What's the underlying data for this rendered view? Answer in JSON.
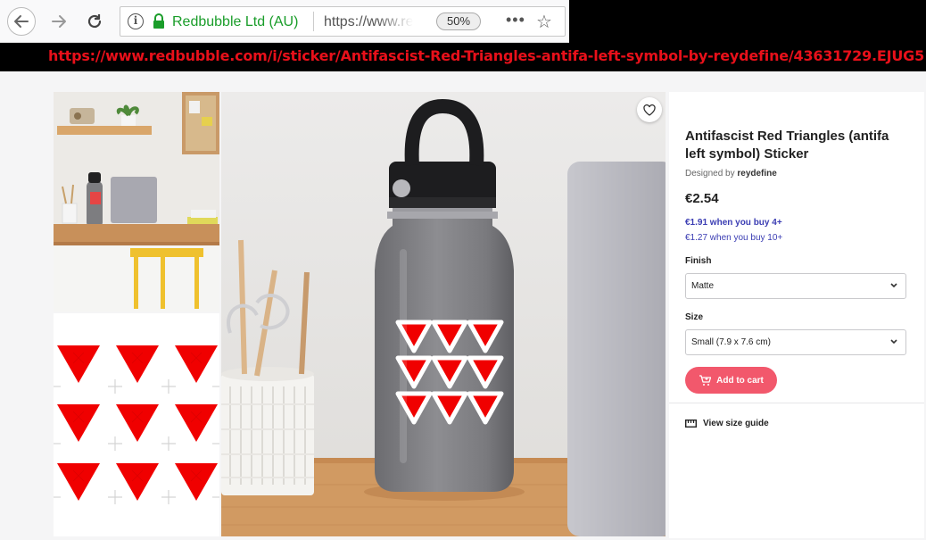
{
  "browser": {
    "org_name": "Redbubble Ltd (AU)",
    "url_partial": "https://www.redbubble.com/i/sticker/",
    "zoom": "50%",
    "menu_dots": "•••",
    "banner_url": "https://www.redbubble.com/i/sticker/Antifascist-Red-Triangles-antifa-left-symbol-by-reydefine/43631729.EJUG5"
  },
  "product": {
    "title": "Antifascist Red Triangles (antifa left symbol) Sticker",
    "designed_by_label": "Designed by",
    "designer": "reydefine",
    "price": "€2.54",
    "bulk_price_1": "€1.91 when you buy 4+",
    "bulk_price_2": "€1.27 when you buy 10+",
    "finish_label": "Finish",
    "finish_value": "Matte",
    "size_label": "Size",
    "size_value": "Small (7.9 x 7.6 cm)",
    "add_to_cart": "Add to cart",
    "size_guide": "View size guide"
  },
  "colors": {
    "accent": "#f2586c",
    "sticker_red": "#f00000",
    "link_blue": "#3b3db3",
    "org_green": "#1a9d2a",
    "banner_red": "#e8101a"
  }
}
